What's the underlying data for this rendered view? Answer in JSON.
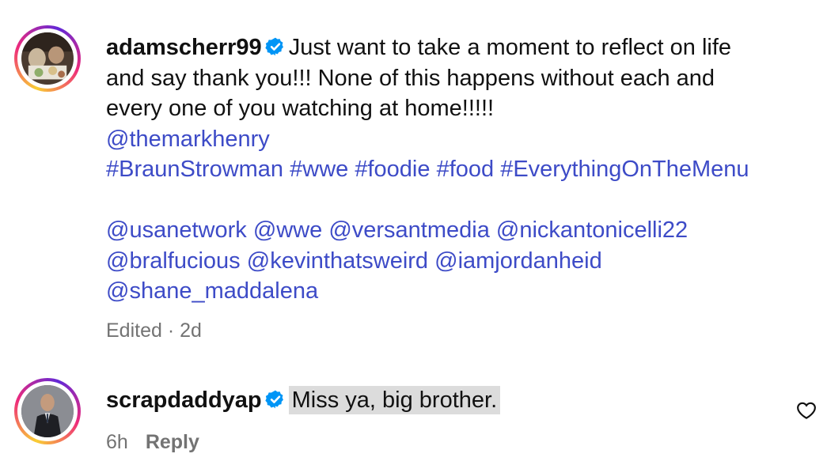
{
  "comments": [
    {
      "username": "adamscherr99",
      "verified": true,
      "text": "Just want to take a moment to reflect on life and say thank you!!! None of this happens without each and every one of you watching at home!!!!!",
      "lines": [
        "Just want to take a moment to reflect on life",
        "and say thank you!!! None of this happens without each and",
        "every one of you watching at home!!!!!"
      ],
      "mention_line1": [
        "@themarkhenry"
      ],
      "hashtags": [
        "#BraunStrowman",
        "#wwe",
        "#foodie",
        "#food",
        "#EverythingOnTheMenu"
      ],
      "mention_line2": [
        "@usanetwork",
        "@wwe",
        "@versantmedia",
        "@nickantonicelli22"
      ],
      "mention_line3": [
        "@bralfucious",
        "@kevinthatsweird",
        "@iamjordanheid"
      ],
      "mention_line4": [
        "@shane_maddalena"
      ],
      "meta": "Edited · 2d"
    },
    {
      "username": "scrapdaddyap",
      "verified": true,
      "text": "Miss ya, big brother.",
      "time": "6h",
      "reply_label": "Reply"
    }
  ],
  "colors": {
    "link": "#3d4bc7",
    "verified": "#0095f6",
    "meta": "#737373",
    "highlight": "#dcdcdc"
  },
  "icons": [
    "verified-badge-icon",
    "heart-icon"
  ]
}
